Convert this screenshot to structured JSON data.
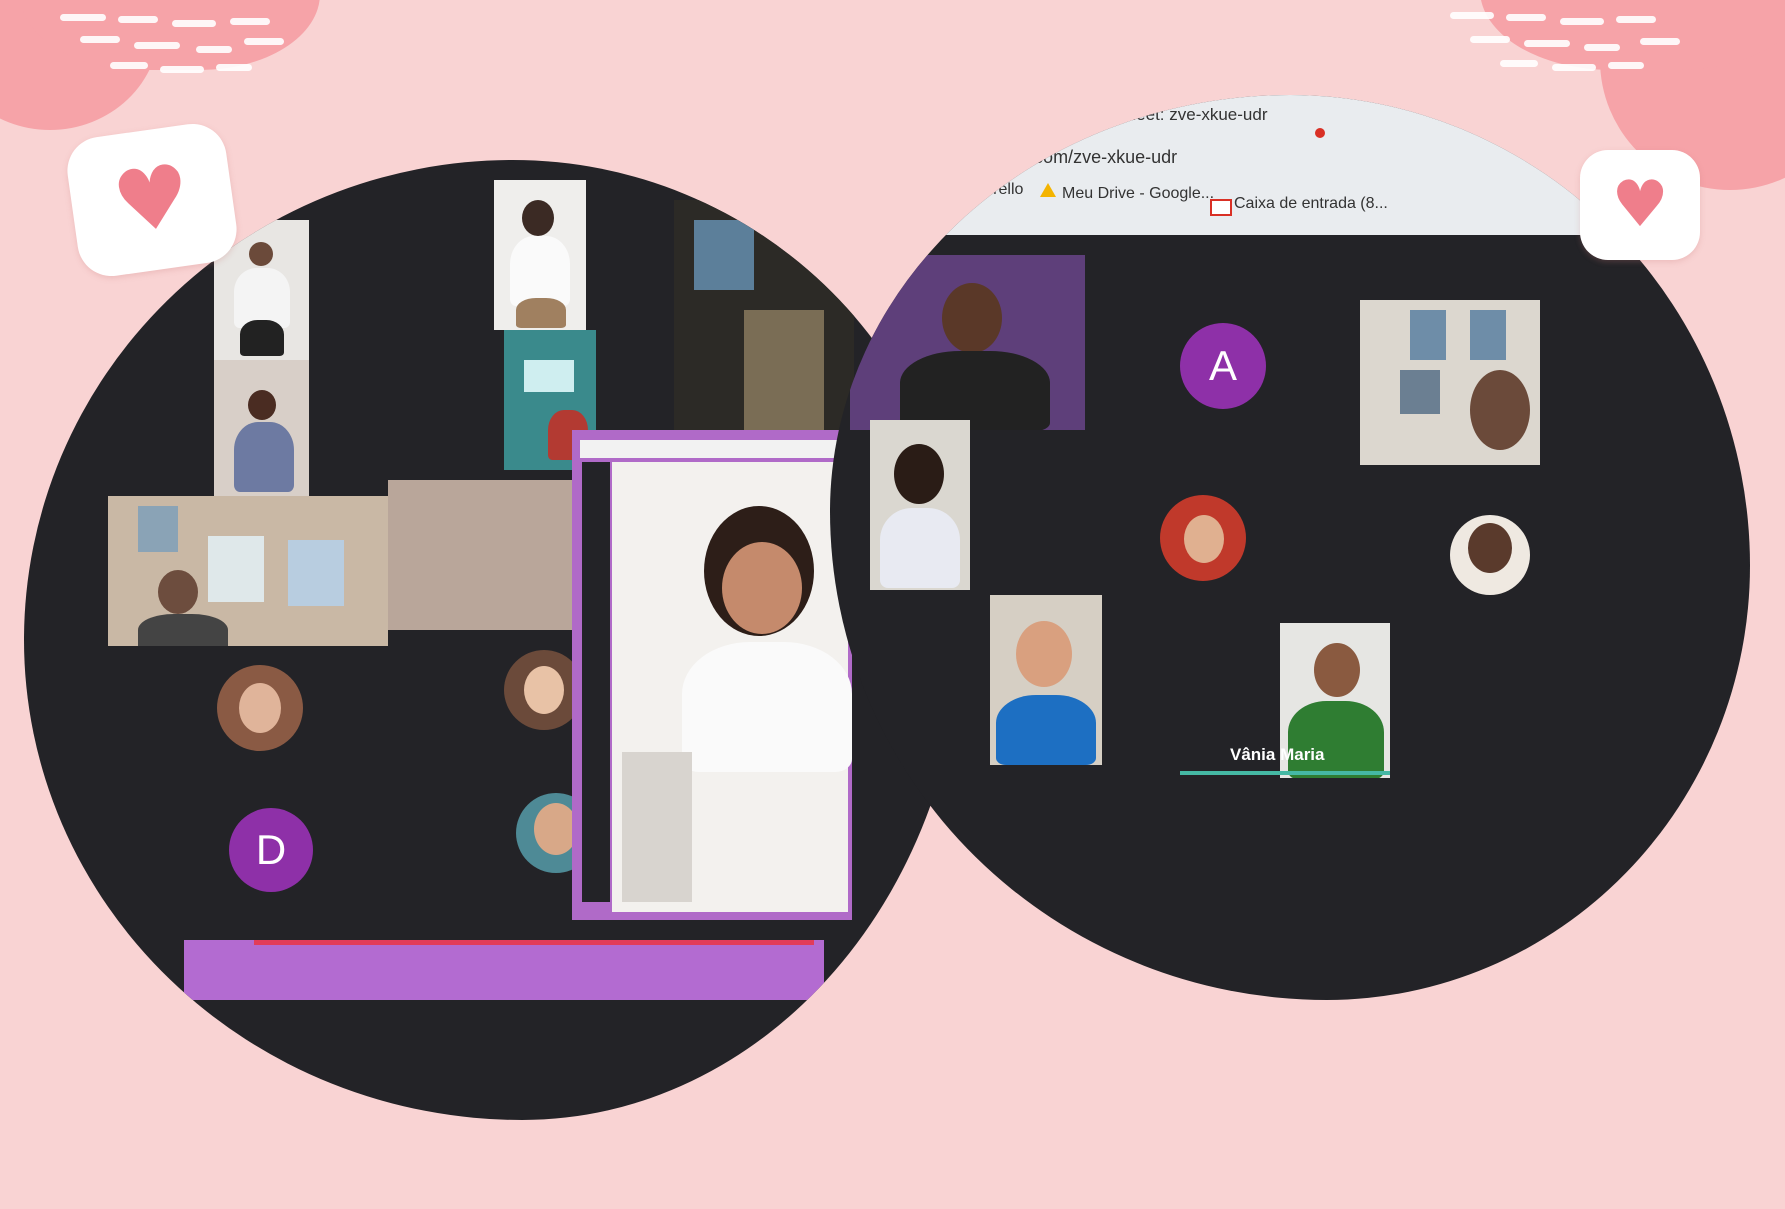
{
  "left_call": {
    "avatar_letter": "D"
  },
  "right_call": {
    "browser": {
      "tab_title": "Meet: zve-xkue-udr",
      "url": "...google.com/zve-xkue-udr",
      "bookmarks": [
        "...iulas | Trello",
        "Meu Drive - Google...",
        "Caixa de entrada (8..."
      ]
    },
    "avatar_letter": "A",
    "speaker_name": "Vânia Maria"
  },
  "colors": {
    "background": "#f9d3d3",
    "blob": "#f6a3a8",
    "call_dark": "#232327",
    "avatar_purple": "#8e30a8",
    "heart": "#ef7e8b"
  },
  "icons": [
    "heart-icon",
    "heart-icon",
    "google-drive-icon",
    "gmail-icon",
    "google-meet-icon"
  ]
}
